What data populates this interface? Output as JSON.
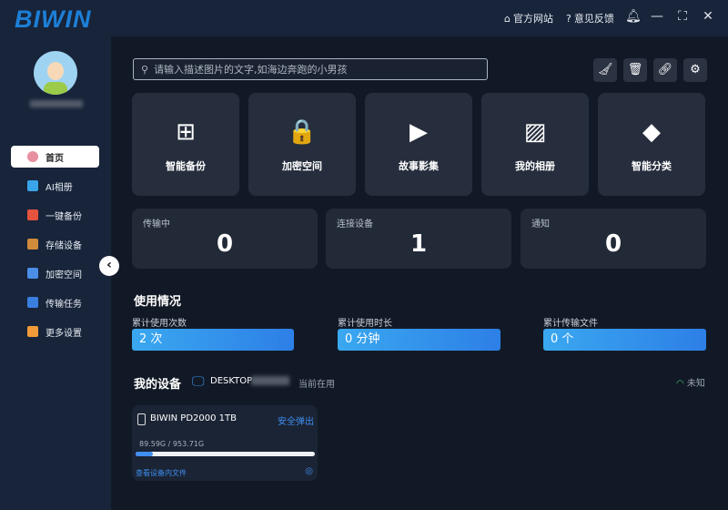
{
  "app": {
    "logo": "BIWIN",
    "website": "官方网站",
    "feedback": "意见反馈"
  },
  "sidebar": {
    "items": [
      {
        "label": "首页",
        "color": "#e88fa0"
      },
      {
        "label": "AI相册",
        "color": "#3aa4ea"
      },
      {
        "label": "一键备份",
        "color": "#e5533f"
      },
      {
        "label": "存储设备",
        "color": "#d08b3c"
      },
      {
        "label": "加密空间",
        "color": "#4a8ee6"
      },
      {
        "label": "传输任务",
        "color": "#3a7ee0"
      },
      {
        "label": "更多设置",
        "color": "#f09a3a"
      }
    ]
  },
  "search": {
    "placeholder": "请输入描述图片的文字,如海边奔跑的小男孩"
  },
  "features": [
    {
      "label": "智能备份",
      "icon": "⊞"
    },
    {
      "label": "加密空间",
      "icon": "🔒"
    },
    {
      "label": "故事影集",
      "icon": "▶"
    },
    {
      "label": "我的相册",
      "icon": "▨"
    },
    {
      "label": "智能分类",
      "icon": "◆"
    }
  ],
  "stats": [
    {
      "label": "传输中",
      "value": "0"
    },
    {
      "label": "连接设备",
      "value": "1"
    },
    {
      "label": "通知",
      "value": "0"
    }
  ],
  "usage": {
    "title": "使用情况",
    "items": [
      {
        "label": "累计使用次数",
        "value": "2 次"
      },
      {
        "label": "累计使用时长",
        "value": "0 分钟"
      },
      {
        "label": "累计传输文件",
        "value": "0 个"
      }
    ]
  },
  "devices": {
    "title": "我的设备",
    "computer": "DESKTOP",
    "current": "当前在用",
    "network": "未知",
    "device": {
      "name": "BIWIN PD2000 1TB",
      "eject": "安全弹出",
      "usage": "89.59G / 953.71G",
      "used_fraction": 0.094,
      "view": "查看设备内文件"
    }
  }
}
